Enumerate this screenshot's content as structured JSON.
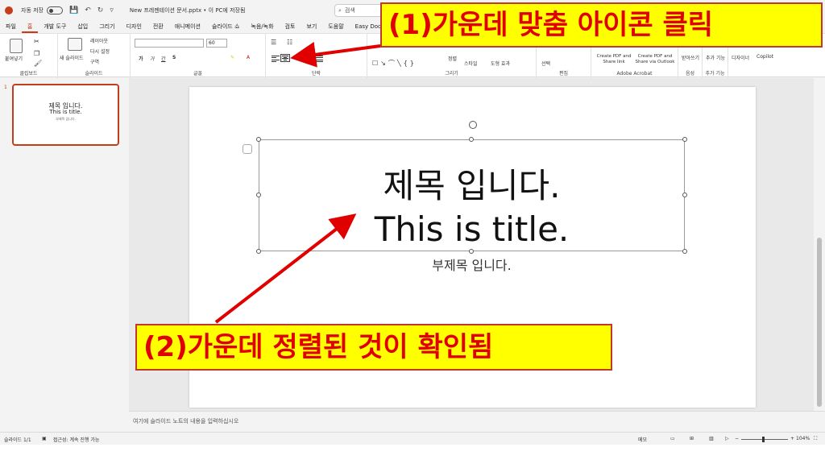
{
  "titlebar": {
    "autosave_label": "자동 저장",
    "toggle_state": "끔",
    "document_title": "New 프레젠테이션 문서.pptx • 이 PC에 저장됨",
    "search_placeholder": "검색"
  },
  "menu": {
    "tabs": [
      "파일",
      "홈",
      "개발 도구",
      "삽입",
      "그리기",
      "디자인",
      "전환",
      "애니메이션",
      "슬라이드 쇼",
      "녹음/녹화",
      "검토",
      "보기",
      "도움말",
      "Easy Document Cr"
    ],
    "active_index": 1
  },
  "ribbon": {
    "clipboard": {
      "paste": "붙여넣기",
      "label": "클립보드"
    },
    "slides": {
      "new_slide": "새 슬라이드",
      "layout": "레이아웃",
      "reset": "다시 설정",
      "section": "구역",
      "label": "슬라이드"
    },
    "font": {
      "size": "60",
      "label": "글꼴"
    },
    "paragraph": {
      "label": "단락"
    },
    "drawing": {
      "arrange": "정렬",
      "styles": "스타일",
      "shape_effects": "도형 효과",
      "label": "그리기"
    },
    "editing": {
      "select": "선택",
      "label": "편집"
    },
    "acrobat": {
      "create_pdf_link": "Create PDF and Share link",
      "create_pdf_outlook": "Create PDF and Share via Outlook",
      "label": "Adobe Acrobat"
    },
    "voice": {
      "dictate": "받아쓰기",
      "label": "음성"
    },
    "addins": {
      "addins": "추가 기능",
      "label": "추가 기능"
    },
    "designer": "디자이너",
    "copilot": "Copilot"
  },
  "thumbnail": {
    "number": "1",
    "title_line1": "제목 입니다.",
    "title_line2": "This is title.",
    "subtitle": "부제목 입니다."
  },
  "slide": {
    "title_line1": "제목 입니다.",
    "title_line2": "This is title.",
    "subtitle": "부제목 입니다."
  },
  "notes": {
    "placeholder": "여기에 슬라이드 노트의 내용을 입력하십시오"
  },
  "status": {
    "slide_count": "슬라이드 1/1",
    "accessibility": "접근성: 계속 진행 가능",
    "notes_btn": "메모",
    "zoom": "104%"
  },
  "annotations": {
    "step1": "(1)가운데 맞춤 아이콘 클릭",
    "step2": "(2)가운데 정렬된 것이 확인됨",
    "arrow_color": "#e00000",
    "box_color": "#ffff00"
  }
}
